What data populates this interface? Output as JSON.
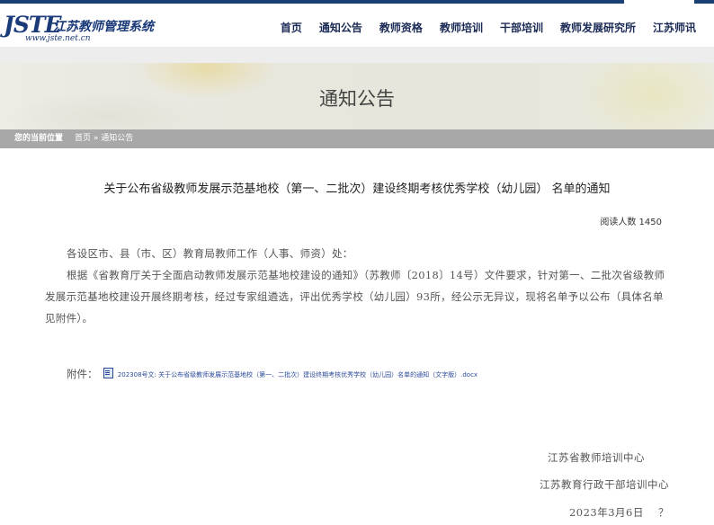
{
  "header": {
    "logo_mark": "JSTE",
    "logo_title": "江苏教师管理系统",
    "logo_url": "www.jste.net.cn"
  },
  "nav": {
    "items": [
      "首页",
      "通知公告",
      "教师资格",
      "教师培训",
      "干部培训",
      "教师发展研究所",
      "江苏师讯"
    ]
  },
  "banner": {
    "title": "通知公告"
  },
  "breadcrumb": {
    "label": "您的当前位置",
    "path": "首页 » 通知公告"
  },
  "article": {
    "title": "关于公布省级教师发展示范基地校（第一、二批次）建设终期考核优秀学校（幼儿园） 名单的通知",
    "read_count_label": "阅读人数 1450",
    "greeting": "各设区市、县（市、区）教育局教师工作（人事、师资）处：",
    "body": "根据《省教育厅关于全面启动教师发展示范基地校建设的通知》（苏教师〔2018〕14号）文件要求，针对第一、二批次省级教师发展示范基地校建设开展终期考核，经过专家组遴选，评出优秀学校（幼儿园）93所，经公示无异议，现将名单予以公布（具体名单见附件）。",
    "attachment_label": "附件：",
    "attachment_link": "202308号文: 关于公布省级教师发展示范基地校（第一、二批次）建设终期考核优秀学校（幼儿园）名单的通知（文字版）.docx",
    "signatures": [
      "江苏省教师培训中心",
      "江苏教育行政干部培训中心",
      "2023年3月6日　 ？"
    ]
  }
}
